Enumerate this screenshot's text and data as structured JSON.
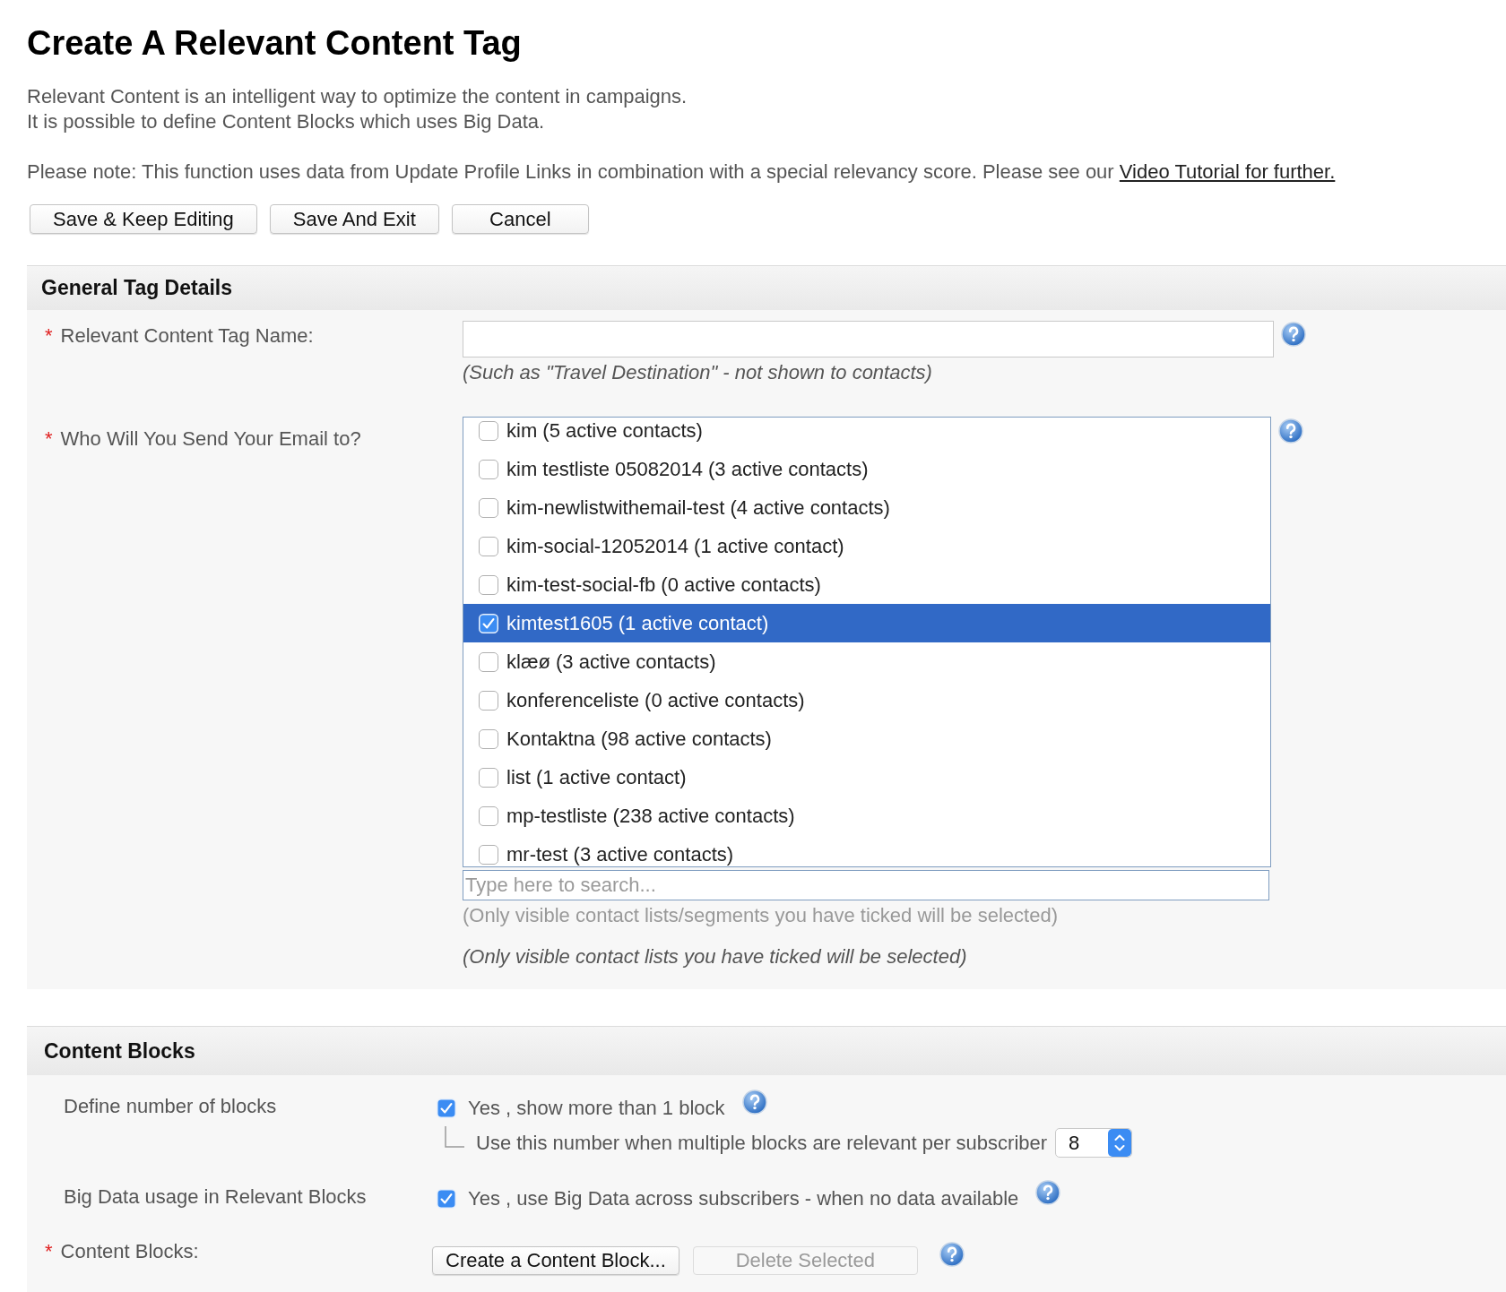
{
  "title": "Create A Relevant Content Tag",
  "intro": [
    "Relevant Content is an intelligent way to optimize the content in campaigns.",
    "It is possible to define Content Blocks which uses Big Data."
  ],
  "note": {
    "text": "Please note: This function uses data from Update Profile Links in combination with a special relevancy score. Please see our",
    "link": "Video Tutorial for further."
  },
  "actions": [
    {
      "label": "Save & Keep Editing"
    },
    {
      "label": "Save And Exit"
    },
    {
      "label": "Cancel"
    }
  ],
  "general": {
    "title": "General Tag Details",
    "tag_name": {
      "marker": "*",
      "label": "Relevant Content Tag Name:",
      "hint": "(Such as \"Travel Destination\" - not shown to contacts)"
    },
    "recipients": {
      "marker": "*",
      "label": "Who Will You Send Your Email to?",
      "lists": [
        {
          "name": "kim (5 active contacts)",
          "checked": false,
          "selected": false
        },
        {
          "name": "kim testliste 05082014 (3 active contacts)",
          "checked": false,
          "selected": false
        },
        {
          "name": "kim-newlistwithemail-test (4 active contacts)",
          "checked": false,
          "selected": false
        },
        {
          "name": "kim-social-12052014 (1 active contact)",
          "checked": false,
          "selected": false
        },
        {
          "name": "kim-test-social-fb (0 active contacts)",
          "checked": false,
          "selected": false
        },
        {
          "name": "kimtest1605 (1 active contact)",
          "checked": true,
          "selected": true
        },
        {
          "name": "klæø (3 active contacts)",
          "checked": false,
          "selected": false
        },
        {
          "name": "konferenceliste (0 active contacts)",
          "checked": false,
          "selected": false
        },
        {
          "name": "Kontaktna (98 active contacts)",
          "checked": false,
          "selected": false
        },
        {
          "name": "list (1 active contact)",
          "checked": false,
          "selected": false
        },
        {
          "name": "mp-testliste (238 active contacts)",
          "checked": false,
          "selected": false
        },
        {
          "name": "mr-test (3 active contacts)",
          "checked": false,
          "selected": false
        }
      ],
      "search": {
        "placeholder": "Type here to search..."
      },
      "search_note": "(Only visible contact lists/segments you have ticked will be selected)",
      "hint": "(Only visible contact lists you have ticked will be selected)"
    }
  },
  "content_blocks": {
    "title": "Content Blocks",
    "rows": [
      {
        "kind": "option",
        "label": "Define number of blocks",
        "option": {
          "text": "Yes , show more than 1 block",
          "checked": true
        },
        "limit": {
          "text": "Use this number when multiple blocks are relevant per subscriber",
          "value": "8"
        }
      },
      {
        "kind": "option",
        "label": "Big Data usage in Relevant Blocks",
        "option": {
          "text": "Yes , use Big Data across subscribers - when no data available",
          "checked": true
        }
      },
      {
        "kind": "buttons",
        "marker": "*",
        "label": "Content Blocks:",
        "buttons": [
          {
            "label": "Create a Content Block...",
            "disabled": false
          },
          {
            "label": "Delete Selected",
            "disabled": true
          }
        ]
      }
    ]
  }
}
